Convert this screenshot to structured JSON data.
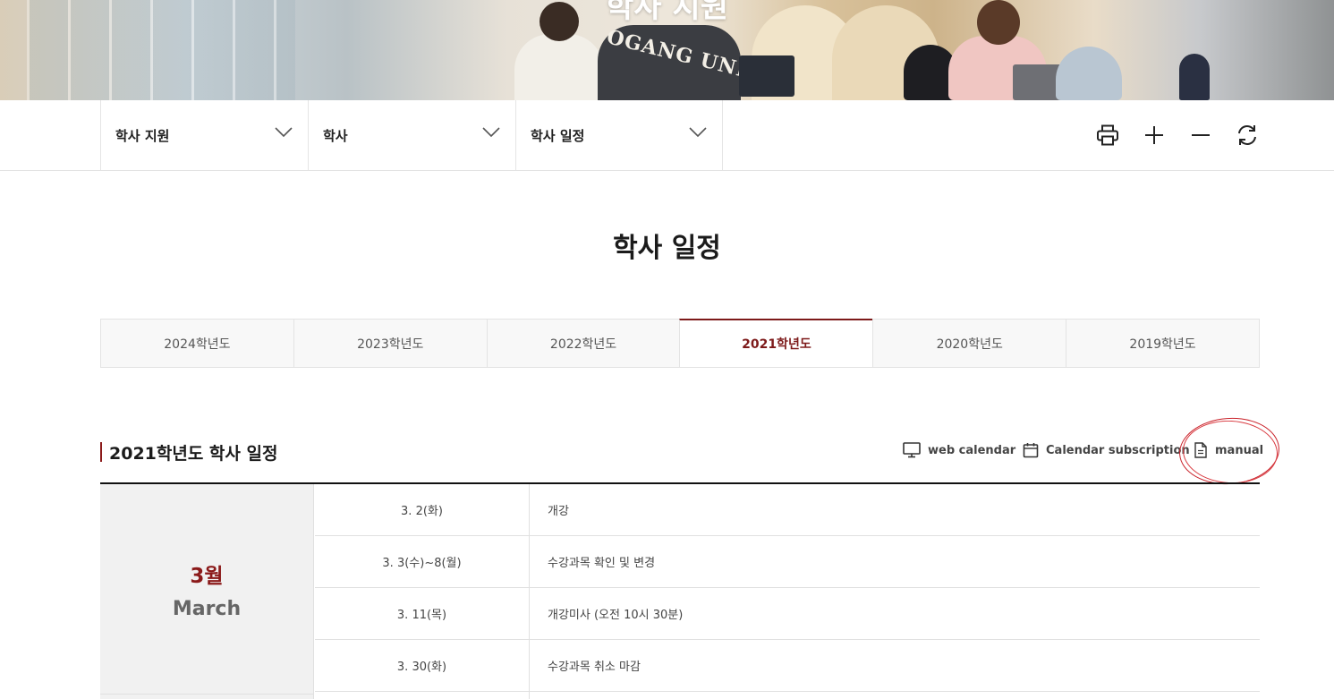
{
  "hero": {
    "title": "학사 지원",
    "jacket_text": "OGANG UNIV."
  },
  "nav": {
    "dropdowns": [
      {
        "label": "학사 지원"
      },
      {
        "label": "학사"
      },
      {
        "label": "학사 일정"
      }
    ],
    "tools": [
      "printer-icon",
      "plus-icon",
      "minus-icon",
      "refresh-icon"
    ]
  },
  "page_title": "학사 일정",
  "year_tabs": [
    {
      "label": "2024학년도",
      "active": false
    },
    {
      "label": "2023학년도",
      "active": false
    },
    {
      "label": "2022학년도",
      "active": false
    },
    {
      "label": "2021학년도",
      "active": true
    },
    {
      "label": "2020학년도",
      "active": false
    },
    {
      "label": "2019학년도",
      "active": false
    }
  ],
  "section": {
    "title": "2021학년도 학사 일정",
    "links": {
      "web_calendar": "web calendar",
      "subscription": "Calendar subscription",
      "manual": "manual"
    }
  },
  "schedule": {
    "month_ko": "3월",
    "month_en": "March",
    "rows": [
      {
        "date": "3. 2(화)",
        "event": "개강"
      },
      {
        "date": "3. 3(수)~8(월)",
        "event": "수강과목 확인 및 변경"
      },
      {
        "date": "3. 11(목)",
        "event": "개강미사 (오전 10시 30분)"
      },
      {
        "date": "3. 30(화)",
        "event": "수강과목 취소 마감"
      }
    ]
  },
  "colors": {
    "accent": "#8b1a1a",
    "annotation": "#c9222a"
  }
}
